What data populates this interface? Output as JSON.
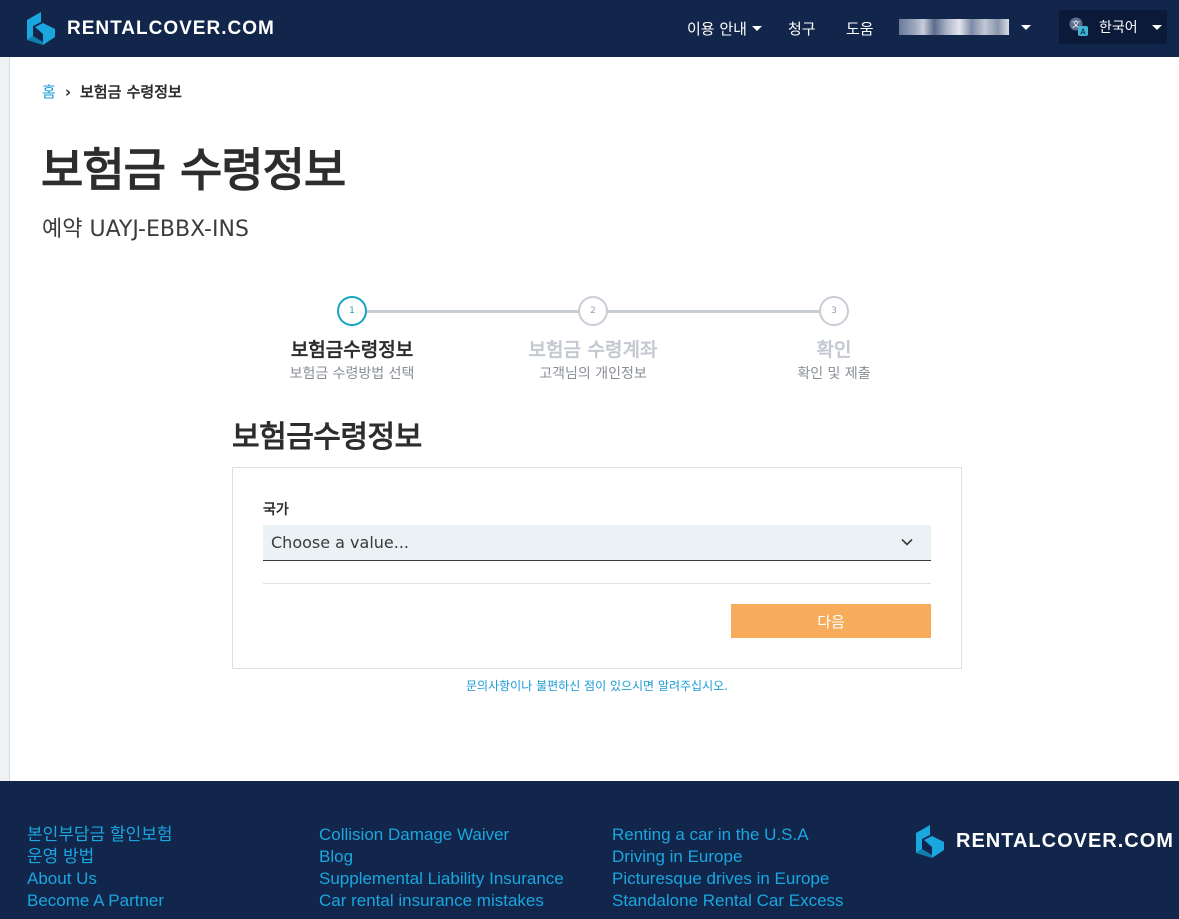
{
  "header": {
    "brand": "RENTALCOVER.COM",
    "nav": {
      "guide": "이용 안내",
      "claim": "청구",
      "help": "도움"
    },
    "language": "한국어"
  },
  "breadcrumb": {
    "home": "홈",
    "separator": "›",
    "current": "보험금 수령정보"
  },
  "page": {
    "title": "보험금 수령정보",
    "booking_ref": "예약 UAYJ-EBBX-INS"
  },
  "steps": [
    {
      "number": "1",
      "title": "보험금수령정보",
      "subtitle": "보험금 수령방법 선택"
    },
    {
      "number": "2",
      "title": "보험금 수령계좌",
      "subtitle": "고객님의 개인정보"
    },
    {
      "number": "3",
      "title": "확인",
      "subtitle": "확인 및 제출"
    }
  ],
  "form": {
    "section_title": "보험금수령정보",
    "country_label": "국가",
    "country_value": "Choose a value...",
    "next_button": "다음"
  },
  "contact_text": "문의사항이나 불편하신 점이 있으시면 알려주십시오.",
  "footer": {
    "col1": [
      "본인부담금 할인보험",
      "운영 방법",
      "About Us",
      "Become A Partner"
    ],
    "col2": [
      "Collision Damage Waiver",
      "Blog",
      "Supplemental Liability Insurance",
      "Car rental insurance mistakes"
    ],
    "col3": [
      "Renting a car in the U.S.A",
      "Driving in Europe",
      "Picturesque drives in Europe",
      "Standalone Rental Car Excess"
    ],
    "brand": "RENTALCOVER.COM"
  },
  "colors": {
    "header_bg": "#12254a",
    "accent": "#1a9bd7",
    "step_active": "#17a3c2",
    "next_button": "#f6ac5b"
  }
}
